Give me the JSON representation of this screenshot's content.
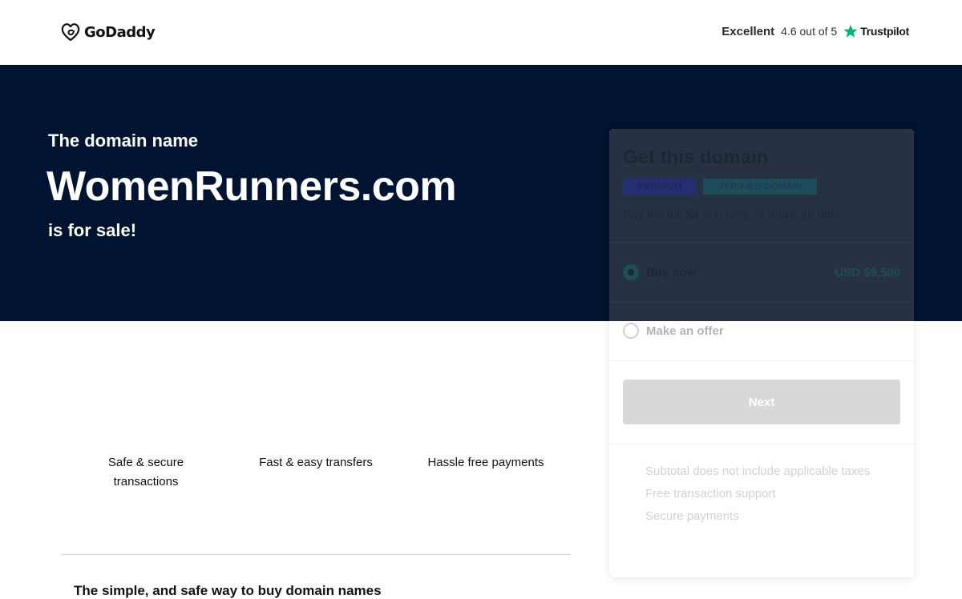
{
  "header": {
    "logo_text": "GoDaddy",
    "rating_label": "Excellent",
    "rating_score": "4.6 out of 5",
    "rating_provider": "Trustpilot"
  },
  "hero": {
    "subtitle": "The domain name",
    "domain": "WomenRunners.com",
    "sale_text": "is for sale!"
  },
  "features": [
    {
      "label": "Safe & secure transactions"
    },
    {
      "label": "Fast & easy transfers"
    },
    {
      "label": "Hassle free payments"
    }
  ],
  "bottom_heading": "The simple, and safe way to buy domain names",
  "card": {
    "title": "Get this domain",
    "badges": [
      "PREMIUM",
      "VERIFIED DOMAIN"
    ],
    "description": "Pay the full $9,500 now, or make an offer.",
    "options": [
      {
        "label": "Buy now",
        "price": "USD $9,500",
        "selected": true
      },
      {
        "label": "Make an offer",
        "price": "",
        "selected": false
      }
    ],
    "next_label": "Next",
    "info": [
      "Subtotal does not include applicable taxes",
      "Free transaction support",
      "Secure payments"
    ]
  },
  "colors": {
    "hero_bg": "#001330",
    "accent_teal": "#0a8a8a",
    "trustpilot_green": "#00b67a"
  }
}
